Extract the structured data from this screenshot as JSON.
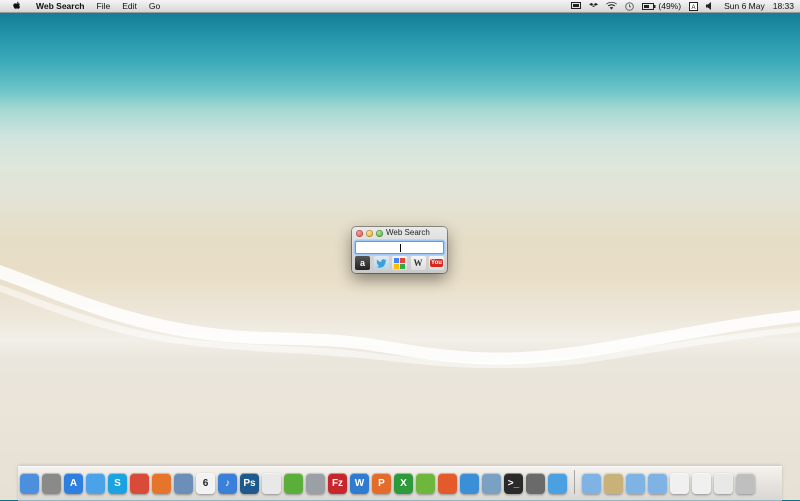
{
  "menubar": {
    "app_name": "Web Search",
    "menus": [
      "File",
      "Edit",
      "Go"
    ],
    "battery": "(49%)",
    "date": "Sun 6 May",
    "time": "18:33"
  },
  "window": {
    "title": "Web Search",
    "search_value": "",
    "engines": [
      {
        "name": "amazon",
        "glyph": "a"
      },
      {
        "name": "twitter",
        "glyph": ""
      },
      {
        "name": "google",
        "glyph": ""
      },
      {
        "name": "wikipedia",
        "glyph": "W"
      },
      {
        "name": "youtube",
        "glyph": "You"
      }
    ]
  },
  "dock": {
    "apps": [
      {
        "name": "finder",
        "color": "#4c8fdc",
        "glyph": ""
      },
      {
        "name": "system-preferences",
        "color": "#8a8a8a",
        "glyph": ""
      },
      {
        "name": "app-store",
        "color": "#2f7fe0",
        "glyph": "A"
      },
      {
        "name": "messages",
        "color": "#4aa3e8",
        "glyph": ""
      },
      {
        "name": "skype",
        "color": "#1aa3e0",
        "glyph": "S"
      },
      {
        "name": "chrome",
        "color": "#d94a38",
        "glyph": ""
      },
      {
        "name": "firefox",
        "color": "#e5752a",
        "glyph": ""
      },
      {
        "name": "preview",
        "color": "#6b8fb8",
        "glyph": ""
      },
      {
        "name": "calendar",
        "color": "#f2f2f2",
        "glyph": "6"
      },
      {
        "name": "itunes",
        "color": "#3b7fd8",
        "glyph": "♪"
      },
      {
        "name": "photoshop",
        "color": "#1f5a8c",
        "glyph": "Ps"
      },
      {
        "name": "textedit",
        "color": "#e8e8e8",
        "glyph": ""
      },
      {
        "name": "evernote",
        "color": "#5cae3a",
        "glyph": ""
      },
      {
        "name": "automator",
        "color": "#9aa0a6",
        "glyph": ""
      },
      {
        "name": "filezilla",
        "color": "#c8262d",
        "glyph": "Fz"
      },
      {
        "name": "word",
        "color": "#2f7bd0",
        "glyph": "W"
      },
      {
        "name": "powerpoint",
        "color": "#e36c2a",
        "glyph": "P"
      },
      {
        "name": "excel",
        "color": "#2f9a3c",
        "glyph": "X"
      },
      {
        "name": "plant",
        "color": "#6fb63c",
        "glyph": ""
      },
      {
        "name": "netbeans",
        "color": "#e35b2a",
        "glyph": ""
      },
      {
        "name": "xcode",
        "color": "#3b8fd6",
        "glyph": ""
      },
      {
        "name": "editor",
        "color": "#7aa0c4",
        "glyph": ""
      },
      {
        "name": "terminal",
        "color": "#2a2a2a",
        "glyph": ">_"
      },
      {
        "name": "activity-monitor",
        "color": "#6a6a6a",
        "glyph": ""
      },
      {
        "name": "spotlight-app",
        "color": "#4aa0e0",
        "glyph": ""
      }
    ],
    "stacks": [
      {
        "name": "applications-folder",
        "color": "#7fb3e4"
      },
      {
        "name": "archive-stack",
        "color": "#c9b27a"
      },
      {
        "name": "documents-folder",
        "color": "#7fb3e4"
      },
      {
        "name": "downloads-folder",
        "color": "#7fb3e4"
      },
      {
        "name": "doc-stack-1",
        "color": "#f0f0f0"
      },
      {
        "name": "doc-stack-2",
        "color": "#f0f0f0"
      },
      {
        "name": "doc-stack-3",
        "color": "#e8e8e8"
      },
      {
        "name": "trash",
        "color": "#bfbfbf"
      }
    ]
  },
  "colors": {
    "accent": "#5e9ee6"
  }
}
